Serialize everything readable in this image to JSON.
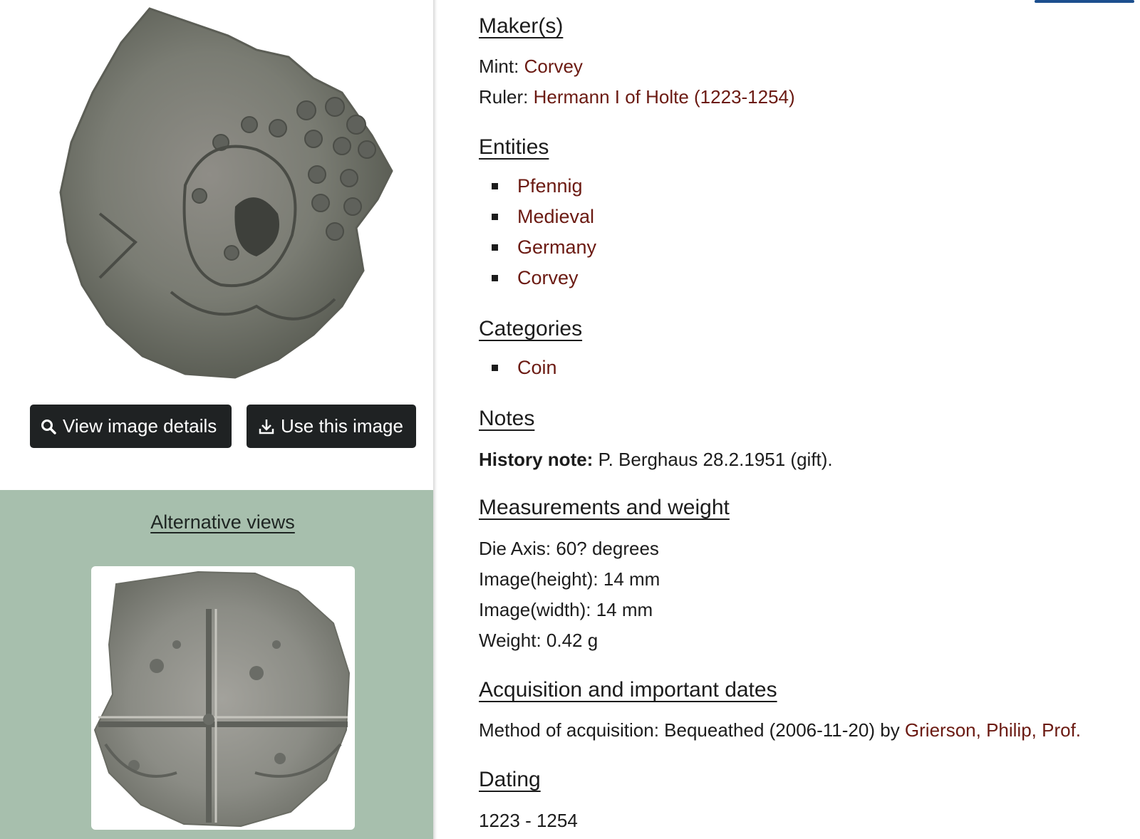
{
  "left": {
    "view_details_label": "View image details",
    "use_image_label": "Use this image",
    "alt_views_title": "Alternative views"
  },
  "makers": {
    "heading": "Maker(s)",
    "mint_label": "Mint:",
    "mint_value": "Corvey",
    "ruler_label": "Ruler:",
    "ruler_value": "Hermann I of Holte (1223-1254)"
  },
  "entities": {
    "heading": "Entities",
    "items": [
      "Pfennig",
      "Medieval",
      "Germany",
      "Corvey"
    ]
  },
  "categories": {
    "heading": "Categories",
    "items": [
      "Coin"
    ]
  },
  "notes": {
    "heading": "Notes",
    "history_label": "History note:",
    "history_value": "P. Berghaus 28.2.1951 (gift)."
  },
  "measurements": {
    "heading": "Measurements and weight",
    "lines": [
      "Die Axis: 60? degrees",
      "Image(height): 14 mm",
      "Image(width): 14 mm",
      "Weight: 0.42 g"
    ]
  },
  "acquisition": {
    "heading": "Acquisition and important dates",
    "method_text": "Method of acquisition: Bequeathed (2006-11-20) by",
    "person": "Grierson, Philip, Prof."
  },
  "dating": {
    "heading": "Dating",
    "value": "1223 - 1254"
  },
  "colors": {
    "link": "#6b1a12",
    "button_bg": "#1f2223",
    "alt_section_bg": "#a7bfad"
  },
  "icons": {
    "view_details": "search-icon",
    "use_image": "download-icon"
  }
}
